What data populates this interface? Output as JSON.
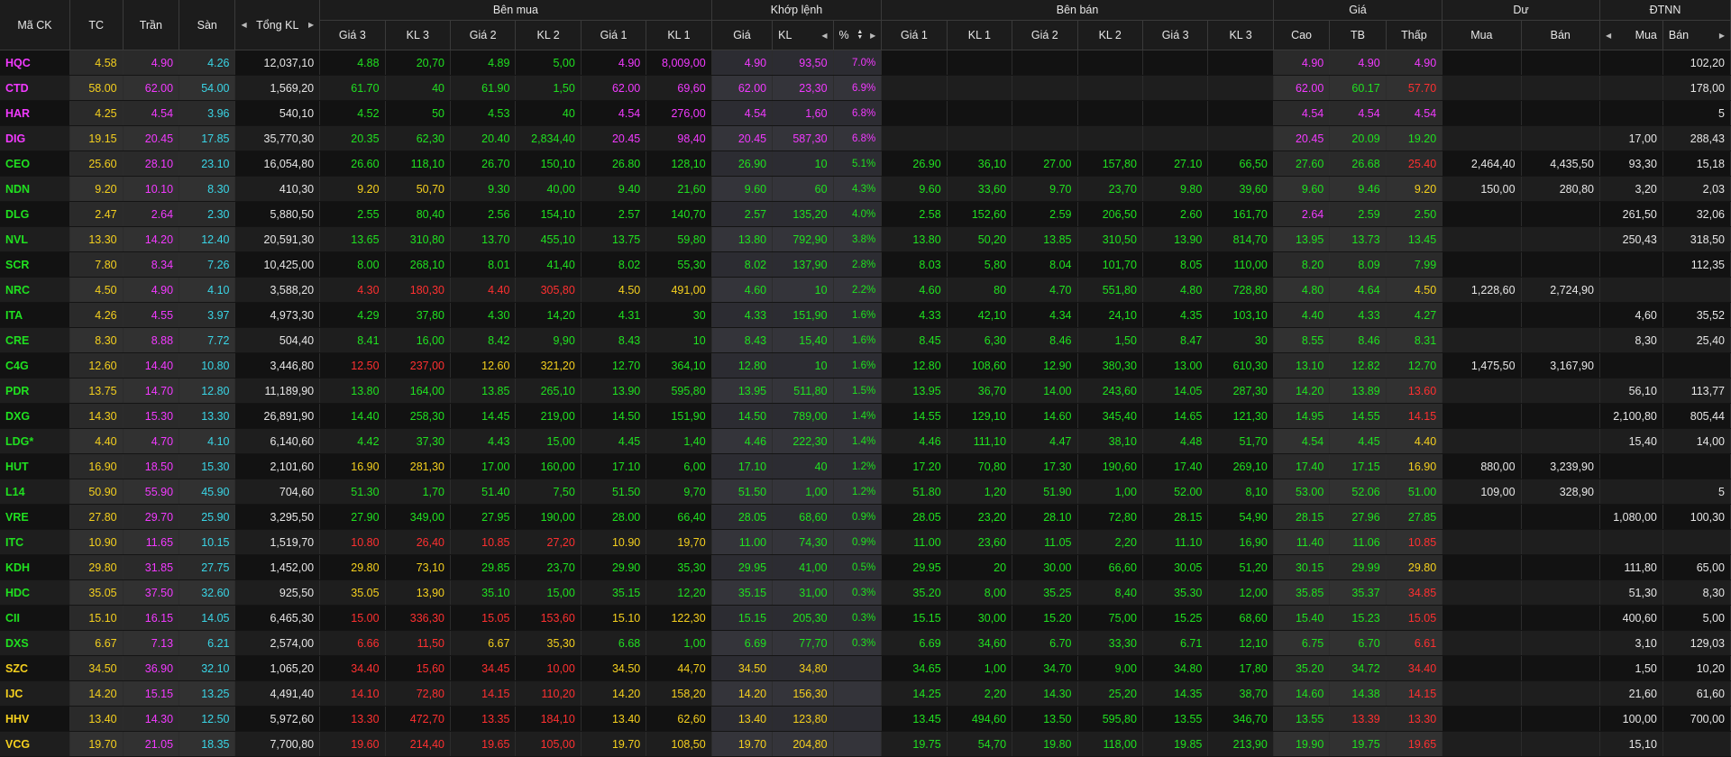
{
  "colors": {
    "ceil": "#f23aff",
    "ref": "#f5d01e",
    "floor": "#3ad5e6",
    "up": "#20e020",
    "down": "#ff3030",
    "plain": "#e6e6e6"
  },
  "headers": {
    "symbol": "Mã CK",
    "ref": "TC",
    "ceil": "Trần",
    "floor": "Sàn",
    "total_vol": "Tổng KL",
    "buy": "Bên mua",
    "match": "Khớp lệnh",
    "sell": "Bên bán",
    "price": "Giá",
    "remain": "Dư",
    "foreign": "ĐTNN",
    "g3": "Giá 3",
    "kl3": "KL 3",
    "g2": "Giá 2",
    "kl2": "KL 2",
    "g1": "Giá 1",
    "kl1": "KL 1",
    "mg": "Giá",
    "mkl": "KL",
    "mpct": "%",
    "high": "Cao",
    "avg": "TB",
    "low": "Thấp",
    "rem_buy": "Mua",
    "rem_sell": "Bán",
    "f_buy": "Mua",
    "f_sell": "Bán"
  },
  "icons": [
    "caret-left-icon",
    "caret-right-icon",
    "sort-toggle-icon"
  ],
  "rows": [
    [
      "HQC",
      "4.58",
      "4.90",
      "4.26",
      "12,037,10",
      "4.88",
      "20,70",
      "4.89",
      "5,00",
      "4.90",
      "8,009,00",
      "4.90",
      "93,50",
      "7.0%",
      "",
      "",
      "",
      "",
      "",
      "",
      "4.90",
      "4.90",
      "4.90",
      "",
      "",
      "",
      "102,20"
    ],
    [
      "CTD",
      "58.00",
      "62.00",
      "54.00",
      "1,569,20",
      "61.70",
      "40",
      "61.90",
      "1,50",
      "62.00",
      "69,60",
      "62.00",
      "23,30",
      "6.9%",
      "",
      "",
      "",
      "",
      "",
      "",
      "62.00",
      "60.17",
      "57.70",
      "",
      "",
      "",
      "178,00"
    ],
    [
      "HAR",
      "4.25",
      "4.54",
      "3.96",
      "540,10",
      "4.52",
      "50",
      "4.53",
      "40",
      "4.54",
      "276,00",
      "4.54",
      "1,60",
      "6.8%",
      "",
      "",
      "",
      "",
      "",
      "",
      "4.54",
      "4.54",
      "4.54",
      "",
      "",
      "",
      "5"
    ],
    [
      "DIG",
      "19.15",
      "20.45",
      "17.85",
      "35,770,30",
      "20.35",
      "62,30",
      "20.40",
      "2,834,40",
      "20.45",
      "98,40",
      "20.45",
      "587,30",
      "6.8%",
      "",
      "",
      "",
      "",
      "",
      "",
      "20.45",
      "20.09",
      "19.20",
      "",
      "",
      "17,00",
      "288,43"
    ],
    [
      "CEO",
      "25.60",
      "28.10",
      "23.10",
      "16,054,80",
      "26.60",
      "118,10",
      "26.70",
      "150,10",
      "26.80",
      "128,10",
      "26.90",
      "10",
      "5.1%",
      "26.90",
      "36,10",
      "27.00",
      "157,80",
      "27.10",
      "66,50",
      "27.60",
      "26.68",
      "25.40",
      "2,464,40",
      "4,435,50",
      "93,30",
      "15,18"
    ],
    [
      "NDN",
      "9.20",
      "10.10",
      "8.30",
      "410,30",
      "9.20",
      "50,70",
      "9.30",
      "40,00",
      "9.40",
      "21,60",
      "9.60",
      "60",
      "4.3%",
      "9.60",
      "33,60",
      "9.70",
      "23,70",
      "9.80",
      "39,60",
      "9.60",
      "9.46",
      "9.20",
      "150,00",
      "280,80",
      "3,20",
      "2,03"
    ],
    [
      "DLG",
      "2.47",
      "2.64",
      "2.30",
      "5,880,50",
      "2.55",
      "80,40",
      "2.56",
      "154,10",
      "2.57",
      "140,70",
      "2.57",
      "135,20",
      "4.0%",
      "2.58",
      "152,60",
      "2.59",
      "206,50",
      "2.60",
      "161,70",
      "2.64",
      "2.59",
      "2.50",
      "",
      "",
      "261,50",
      "32,06"
    ],
    [
      "NVL",
      "13.30",
      "14.20",
      "12.40",
      "20,591,30",
      "13.65",
      "310,80",
      "13.70",
      "455,10",
      "13.75",
      "59,80",
      "13.80",
      "792,90",
      "3.8%",
      "13.80",
      "50,20",
      "13.85",
      "310,50",
      "13.90",
      "814,70",
      "13.95",
      "13.73",
      "13.45",
      "",
      "",
      "250,43",
      "318,50"
    ],
    [
      "SCR",
      "7.80",
      "8.34",
      "7.26",
      "10,425,00",
      "8.00",
      "268,10",
      "8.01",
      "41,40",
      "8.02",
      "55,30",
      "8.02",
      "137,90",
      "2.8%",
      "8.03",
      "5,80",
      "8.04",
      "101,70",
      "8.05",
      "110,00",
      "8.20",
      "8.09",
      "7.99",
      "",
      "",
      "",
      "112,35"
    ],
    [
      "NRC",
      "4.50",
      "4.90",
      "4.10",
      "3,588,20",
      "4.30",
      "180,30",
      "4.40",
      "305,80",
      "4.50",
      "491,00",
      "4.60",
      "10",
      "2.2%",
      "4.60",
      "80",
      "4.70",
      "551,80",
      "4.80",
      "728,80",
      "4.80",
      "4.64",
      "4.50",
      "1,228,60",
      "2,724,90",
      "",
      ""
    ],
    [
      "ITA",
      "4.26",
      "4.55",
      "3.97",
      "4,973,30",
      "4.29",
      "37,80",
      "4.30",
      "14,20",
      "4.31",
      "30",
      "4.33",
      "151,90",
      "1.6%",
      "4.33",
      "42,10",
      "4.34",
      "24,10",
      "4.35",
      "103,10",
      "4.40",
      "4.33",
      "4.27",
      "",
      "",
      "4,60",
      "35,52"
    ],
    [
      "CRE",
      "8.30",
      "8.88",
      "7.72",
      "504,40",
      "8.41",
      "16,00",
      "8.42",
      "9,90",
      "8.43",
      "10",
      "8.43",
      "15,40",
      "1.6%",
      "8.45",
      "6,30",
      "8.46",
      "1,50",
      "8.47",
      "30",
      "8.55",
      "8.46",
      "8.31",
      "",
      "",
      "8,30",
      "25,40"
    ],
    [
      "C4G",
      "12.60",
      "14.40",
      "10.80",
      "3,446,80",
      "12.50",
      "237,00",
      "12.60",
      "321,20",
      "12.70",
      "364,10",
      "12.80",
      "10",
      "1.6%",
      "12.80",
      "108,60",
      "12.90",
      "380,30",
      "13.00",
      "610,30",
      "13.10",
      "12.82",
      "12.70",
      "1,475,50",
      "3,167,90",
      "",
      ""
    ],
    [
      "PDR",
      "13.75",
      "14.70",
      "12.80",
      "11,189,90",
      "13.80",
      "164,00",
      "13.85",
      "265,10",
      "13.90",
      "595,80",
      "13.95",
      "511,80",
      "1.5%",
      "13.95",
      "36,70",
      "14.00",
      "243,60",
      "14.05",
      "287,30",
      "14.20",
      "13.89",
      "13.60",
      "",
      "",
      "56,10",
      "113,77"
    ],
    [
      "DXG",
      "14.30",
      "15.30",
      "13.30",
      "26,891,90",
      "14.40",
      "258,30",
      "14.45",
      "219,00",
      "14.50",
      "151,90",
      "14.50",
      "789,00",
      "1.4%",
      "14.55",
      "129,10",
      "14.60",
      "345,40",
      "14.65",
      "121,30",
      "14.95",
      "14.55",
      "14.15",
      "",
      "",
      "2,100,80",
      "805,44"
    ],
    [
      "LDG*",
      "4.40",
      "4.70",
      "4.10",
      "6,140,60",
      "4.42",
      "37,30",
      "4.43",
      "15,00",
      "4.45",
      "1,40",
      "4.46",
      "222,30",
      "1.4%",
      "4.46",
      "111,10",
      "4.47",
      "38,10",
      "4.48",
      "51,70",
      "4.54",
      "4.45",
      "4.40",
      "",
      "",
      "15,40",
      "14,00"
    ],
    [
      "HUT",
      "16.90",
      "18.50",
      "15.30",
      "2,101,60",
      "16.90",
      "281,30",
      "17.00",
      "160,00",
      "17.10",
      "6,00",
      "17.10",
      "40",
      "1.2%",
      "17.20",
      "70,80",
      "17.30",
      "190,60",
      "17.40",
      "269,10",
      "17.40",
      "17.15",
      "16.90",
      "880,00",
      "3,239,90",
      "",
      ""
    ],
    [
      "L14",
      "50.90",
      "55.90",
      "45.90",
      "704,60",
      "51.30",
      "1,70",
      "51.40",
      "7,50",
      "51.50",
      "9,70",
      "51.50",
      "1,00",
      "1.2%",
      "51.80",
      "1,20",
      "51.90",
      "1,00",
      "52.00",
      "8,10",
      "53.00",
      "52.06",
      "51.00",
      "109,00",
      "328,90",
      "",
      "5"
    ],
    [
      "VRE",
      "27.80",
      "29.70",
      "25.90",
      "3,295,50",
      "27.90",
      "349,00",
      "27.95",
      "190,00",
      "28.00",
      "66,40",
      "28.05",
      "68,60",
      "0.9%",
      "28.05",
      "23,20",
      "28.10",
      "72,80",
      "28.15",
      "54,90",
      "28.15",
      "27.96",
      "27.85",
      "",
      "",
      "1,080,00",
      "100,30"
    ],
    [
      "ITC",
      "10.90",
      "11.65",
      "10.15",
      "1,519,70",
      "10.80",
      "26,40",
      "10.85",
      "27,20",
      "10.90",
      "19,70",
      "11.00",
      "74,30",
      "0.9%",
      "11.00",
      "23,60",
      "11.05",
      "2,20",
      "11.10",
      "16,90",
      "11.40",
      "11.06",
      "10.85",
      "",
      "",
      "",
      ""
    ],
    [
      "KDH",
      "29.80",
      "31.85",
      "27.75",
      "1,452,00",
      "29.80",
      "73,10",
      "29.85",
      "23,70",
      "29.90",
      "35,30",
      "29.95",
      "41,00",
      "0.5%",
      "29.95",
      "20",
      "30.00",
      "66,60",
      "30.05",
      "51,20",
      "30.15",
      "29.99",
      "29.80",
      "",
      "",
      "111,80",
      "65,00"
    ],
    [
      "HDC",
      "35.05",
      "37.50",
      "32.60",
      "925,50",
      "35.05",
      "13,90",
      "35.10",
      "15,00",
      "35.15",
      "12,20",
      "35.15",
      "31,00",
      "0.3%",
      "35.20",
      "8,00",
      "35.25",
      "8,40",
      "35.30",
      "12,00",
      "35.85",
      "35.37",
      "34.85",
      "",
      "",
      "51,30",
      "8,30"
    ],
    [
      "CII",
      "15.10",
      "16.15",
      "14.05",
      "6,465,30",
      "15.00",
      "336,30",
      "15.05",
      "153,60",
      "15.10",
      "122,30",
      "15.15",
      "205,30",
      "0.3%",
      "15.15",
      "30,00",
      "15.20",
      "75,00",
      "15.25",
      "68,60",
      "15.40",
      "15.23",
      "15.05",
      "",
      "",
      "400,60",
      "5,00"
    ],
    [
      "DXS",
      "6.67",
      "7.13",
      "6.21",
      "2,574,00",
      "6.66",
      "11,50",
      "6.67",
      "35,30",
      "6.68",
      "1,00",
      "6.69",
      "77,70",
      "0.3%",
      "6.69",
      "34,60",
      "6.70",
      "33,30",
      "6.71",
      "12,10",
      "6.75",
      "6.70",
      "6.61",
      "",
      "",
      "3,10",
      "129,03"
    ],
    [
      "SZC",
      "34.50",
      "36.90",
      "32.10",
      "1,065,20",
      "34.40",
      "15,60",
      "34.45",
      "10,00",
      "34.50",
      "44,70",
      "34.50",
      "34,80",
      "",
      "34.65",
      "1,00",
      "34.70",
      "9,00",
      "34.80",
      "17,80",
      "35.20",
      "34.72",
      "34.40",
      "",
      "",
      "1,50",
      "10,20"
    ],
    [
      "IJC",
      "14.20",
      "15.15",
      "13.25",
      "4,491,40",
      "14.10",
      "72,80",
      "14.15",
      "110,20",
      "14.20",
      "158,20",
      "14.20",
      "156,30",
      "",
      "14.25",
      "2,20",
      "14.30",
      "25,20",
      "14.35",
      "38,70",
      "14.60",
      "14.38",
      "14.15",
      "",
      "",
      "21,60",
      "61,60"
    ],
    [
      "HHV",
      "13.40",
      "14.30",
      "12.50",
      "5,972,60",
      "13.30",
      "472,70",
      "13.35",
      "184,10",
      "13.40",
      "62,60",
      "13.40",
      "123,80",
      "",
      "13.45",
      "494,60",
      "13.50",
      "595,80",
      "13.55",
      "346,70",
      "13.55",
      "13.39",
      "13.30",
      "",
      "",
      "100,00",
      "700,00"
    ],
    [
      "VCG",
      "19.70",
      "21.05",
      "18.35",
      "7,700,80",
      "19.60",
      "214,40",
      "19.65",
      "105,00",
      "19.70",
      "108,50",
      "19.70",
      "204,80",
      "",
      "19.75",
      "54,70",
      "19.80",
      "118,00",
      "19.85",
      "213,90",
      "19.90",
      "19.75",
      "19.65",
      "",
      "",
      "15,10",
      ""
    ]
  ]
}
